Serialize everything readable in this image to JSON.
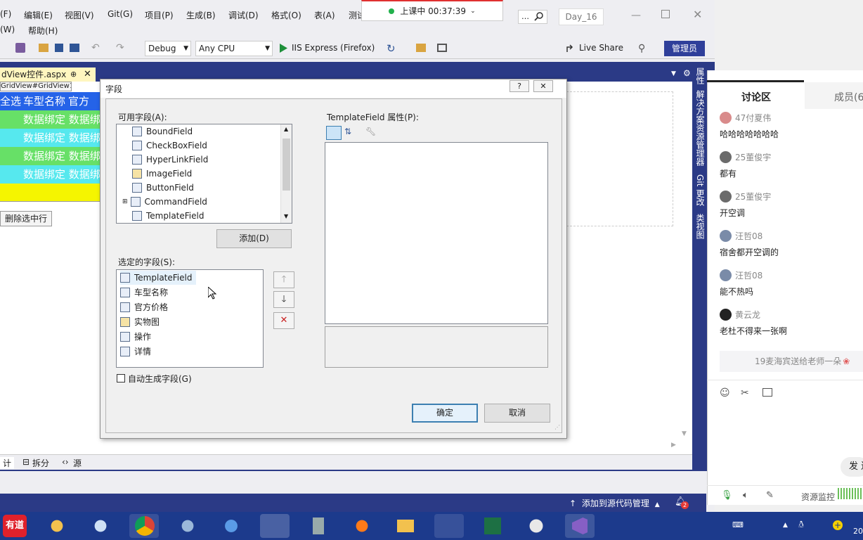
{
  "window": {
    "title": "Day_16"
  },
  "menu": {
    "row1": [
      "(F)",
      "编辑(E)",
      "视图(V)",
      "Git(G)",
      "项目(P)",
      "生成(B)",
      "调试(D)",
      "格式(O)",
      "表(A)",
      "测试"
    ],
    "row2": [
      "(W)",
      "帮助(H)"
    ],
    "search_glyph": "…"
  },
  "meeting": {
    "status": "上课中 00:37:39",
    "status_color": "#22b14c"
  },
  "toolbar": {
    "config": "Debug",
    "platform": "Any CPU",
    "run": "IIS Express (Firefox)",
    "live_share": "Live Share",
    "admin": "管理员"
  },
  "editor": {
    "doc_tab": "dView控件.aspx",
    "breadcrumb": "GridView#GridView1",
    "grid_header": [
      "全选",
      "车型名称",
      "官方"
    ],
    "grid_rows": [
      "数据绑定 数据绑",
      "数据绑定 数据绑",
      "数据绑定 数据绑",
      "数据绑定 数据绑"
    ],
    "delete_button": "删除选中行",
    "bottom_tabs": [
      "计",
      "拆分",
      "源"
    ],
    "vertical_tabs": [
      "属性",
      "解决方案资源管理器",
      "Git 更改",
      "类视图"
    ]
  },
  "dialog": {
    "title": "字段",
    "help": "?",
    "close": "✕",
    "available_label": "可用字段(A):",
    "available_fields": [
      "BoundField",
      "CheckBoxField",
      "HyperLinkField",
      "ImageField",
      "ButtonField",
      "CommandField",
      "TemplateField"
    ],
    "add_button": "添加(D)",
    "selected_label": "选定的字段(S):",
    "selected_fields": [
      "TemplateField",
      "车型名称",
      "官方价格",
      "实物图",
      "操作",
      "详情"
    ],
    "auto_generate": "自动生成字段(G)",
    "props_label": "TemplateField 属性(P):",
    "ok": "确定",
    "cancel": "取消"
  },
  "chat": {
    "tabs": [
      "讨论区",
      "成员(6"
    ],
    "messages": [
      {
        "user": "47付夏伟",
        "text": "哈哈哈哈哈哈哈"
      },
      {
        "user": "25董俊宇",
        "text": "都有"
      },
      {
        "user": "25董俊宇",
        "text": "开空调"
      },
      {
        "user": "汪哲08",
        "text": "宿舍都开空调的"
      },
      {
        "user": "汪哲08",
        "text": "能不热吗"
      },
      {
        "user": "黄云龙",
        "text": "老杜不得来一张啊"
      }
    ],
    "gift_notice": "19麦海宾送给老师一朵",
    "send": "发 送",
    "resource_monitor": "资源监控"
  },
  "statusbar": {
    "source_control": "添加到源代码管理",
    "notifications": "2"
  },
  "taskbar": {
    "youdao": "有道",
    "clock": "20"
  }
}
